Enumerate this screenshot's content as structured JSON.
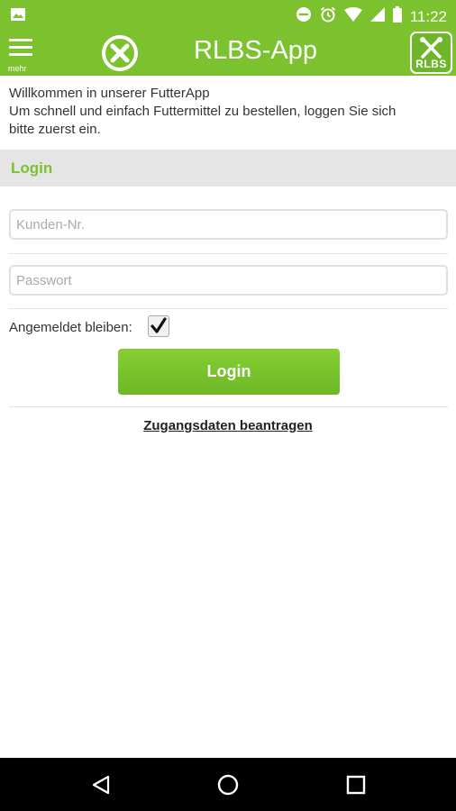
{
  "status_bar": {
    "time": "11:22",
    "icons": [
      "image-notification-icon",
      "do-not-disturb-icon",
      "alarm-icon",
      "wifi-icon",
      "signal-icon",
      "battery-icon"
    ]
  },
  "app_bar": {
    "menu_label": "mehr",
    "title": "RLBS-App",
    "logo_text": "RLBS",
    "accent_color": "#7cc22e"
  },
  "welcome": {
    "line1": "Willkommen in unserer FutterApp",
    "line2": "Um schnell und einfach Futtermittel zu bestellen, loggen Sie sich",
    "line3": "bitte zuerst ein."
  },
  "login": {
    "section_title": "Login",
    "customer_number_placeholder": "Kunden-Nr.",
    "customer_number_value": "",
    "password_placeholder": "Passwort",
    "password_value": "",
    "remember_label": "Angemeldet bleiben:",
    "remember_checked": true,
    "button_label": "Login",
    "request_link": "Zugangsdaten beantragen"
  },
  "nav_bar": {
    "icons": [
      "back-icon",
      "home-icon",
      "recents-icon"
    ]
  }
}
